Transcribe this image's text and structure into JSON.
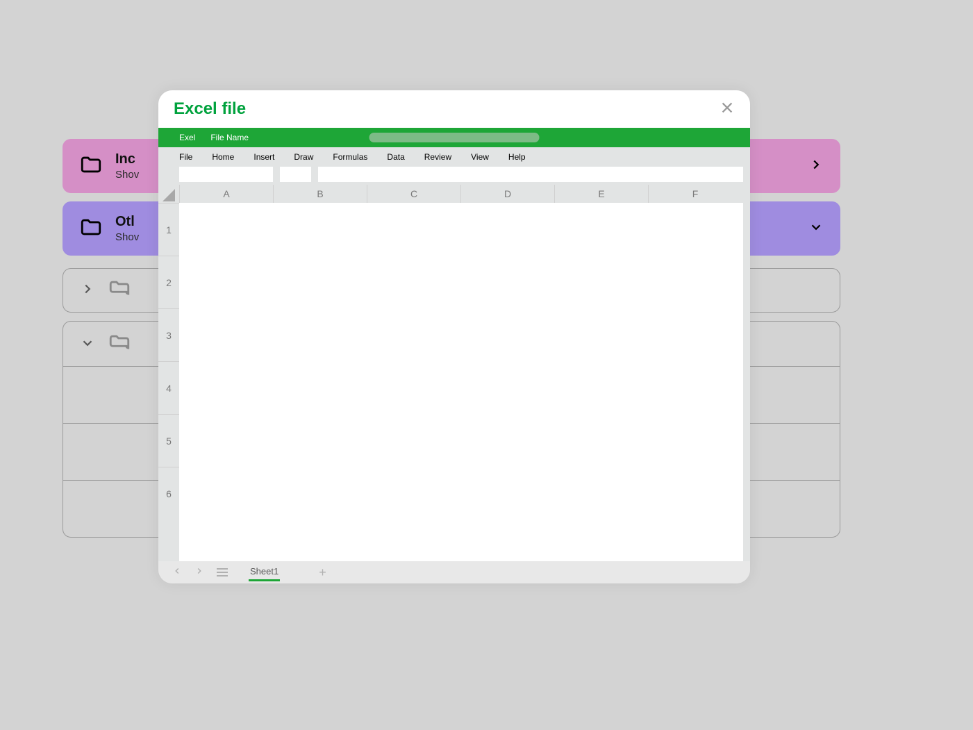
{
  "bg": {
    "card1": {
      "title_prefix": "Inc",
      "sub_prefix": "Shov"
    },
    "card2": {
      "title_prefix": "Otl",
      "sub_prefix": "Shov"
    }
  },
  "modal": {
    "title": "Excel file",
    "green": {
      "app": "Exel",
      "file": "File Name"
    },
    "ribbon": [
      "File",
      "Home",
      "Insert",
      "Draw",
      "Formulas",
      "Data",
      "Review",
      "View",
      "Help"
    ],
    "columns": [
      "A",
      "B",
      "C",
      "D",
      "E",
      "F"
    ],
    "rows": [
      "1",
      "2",
      "3",
      "4",
      "5",
      "6"
    ],
    "sheet_tab": "Sheet1",
    "add_tab": "+"
  },
  "colors": {
    "accent_green": "#1ea637",
    "pink": "#d58fc6",
    "purple": "#9f8ce0"
  }
}
